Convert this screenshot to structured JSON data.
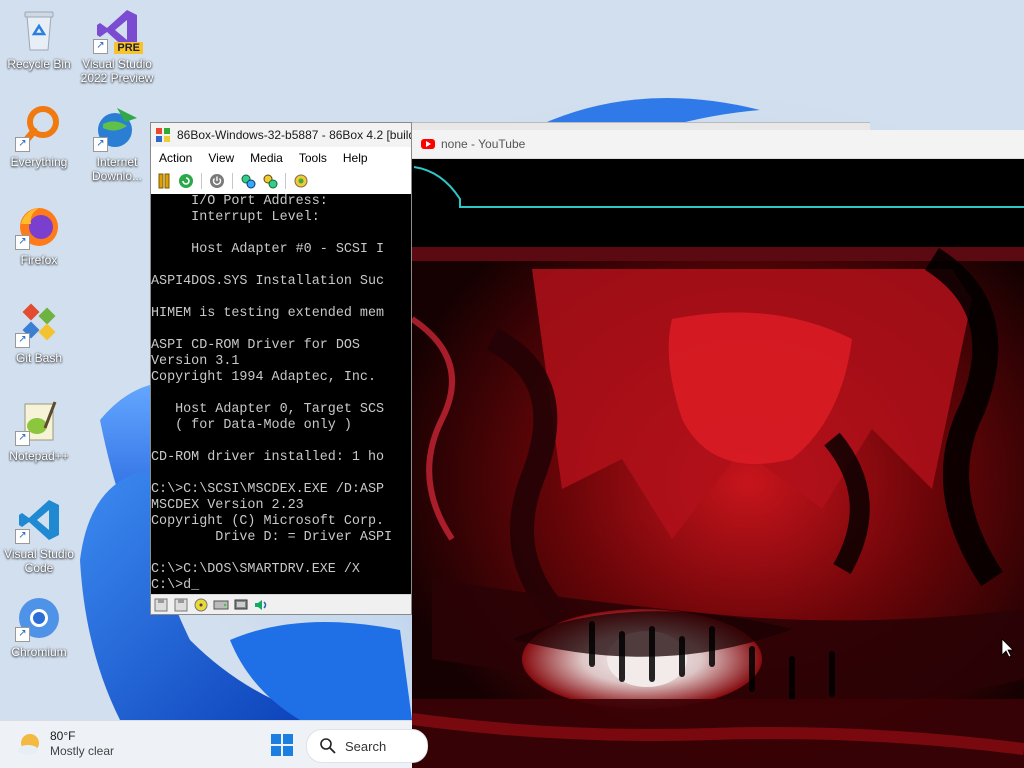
{
  "desktop": {
    "icons": [
      {
        "label": "Recycle Bin",
        "icon": "recycle-bin-icon"
      },
      {
        "label": "Visual Studio 2022 Preview",
        "icon": "visual-studio-preview-icon",
        "badge": "PRE"
      },
      {
        "label": "Everything",
        "icon": "everything-search-icon"
      },
      {
        "label": "Internet Downlo...",
        "icon": "internet-download-manager-icon"
      },
      {
        "label": "Firefox",
        "icon": "firefox-icon"
      },
      {
        "label": "Git Bash",
        "icon": "git-bash-icon"
      },
      {
        "label": "Notepad++",
        "icon": "notepad-plus-plus-icon"
      },
      {
        "label": "Visual Studio Code",
        "icon": "vscode-icon"
      },
      {
        "label": "Chromium",
        "icon": "chromium-icon"
      }
    ]
  },
  "emulator": {
    "title": "86Box-Windows-32-b5887 - 86Box 4.2 [build",
    "menu": [
      "Action",
      "View",
      "Media",
      "Tools",
      "Help"
    ],
    "toolbar": [
      "pause-icon",
      "reset-icon",
      "power-icon",
      "ctrl-alt-del-icon",
      "ctrl-alt-esc-icon",
      "settings-icon"
    ],
    "dos_lines": [
      "     I/O Port Address:",
      "     Interrupt Level:",
      "",
      "     Host Adapter #0 - SCSI I",
      "",
      "ASPI4DOS.SYS Installation Suc",
      "",
      "HIMEM is testing extended mem",
      "",
      "ASPI CD-ROM Driver for DOS",
      "Version 3.1",
      "Copyright 1994 Adaptec, Inc.",
      "",
      "   Host Adapter 0, Target SCS",
      "   ( for Data-Mode only )",
      "",
      "CD-ROM driver installed: 1 ho",
      "",
      "C:\\>C:\\SCSI\\MSCDEX.EXE /D:ASP",
      "MSCDEX Version 2.23",
      "Copyright (C) Microsoft Corp.",
      "        Drive D: = Driver ASPI",
      "",
      "C:\\>C:\\DOS\\SMARTDRV.EXE /X",
      "C:\\>d_"
    ],
    "status_icons": [
      "floppy-a-icon",
      "floppy-b-icon",
      "cdrom-icon",
      "hard-disk-icon",
      "network-icon",
      "sound-icon"
    ]
  },
  "browser": {
    "tab_title": "none - YouTube"
  },
  "taskbar": {
    "weather_temp": "80°F",
    "weather_condition": "Mostly clear",
    "search_label": "Search"
  },
  "colors": {
    "dos_text": "#c8c8c8",
    "youtube_red": "#ff0000",
    "video_red": "#d4141a"
  }
}
